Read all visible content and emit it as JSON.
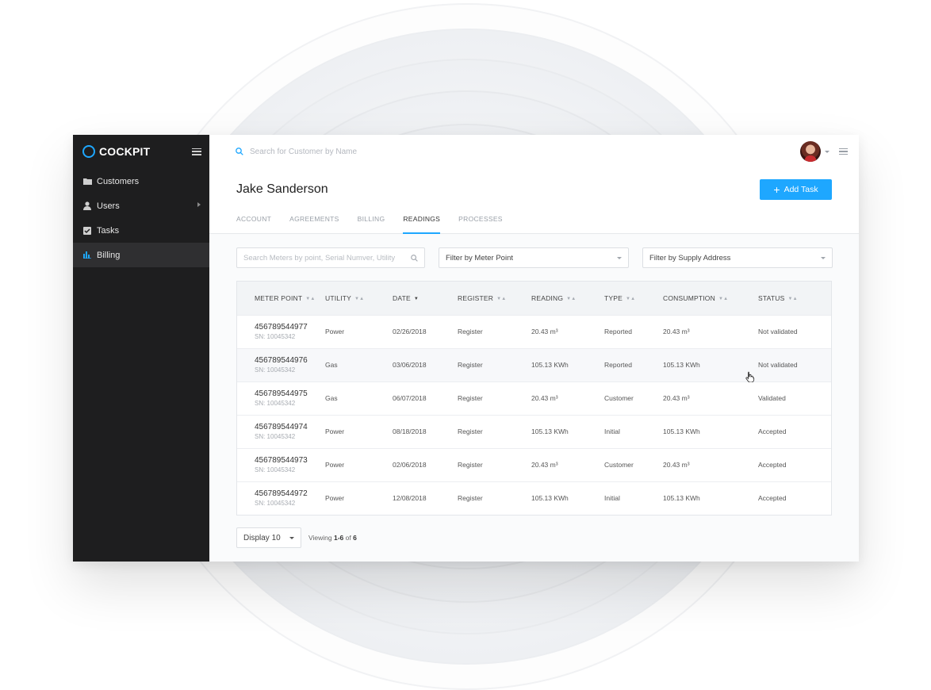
{
  "brand": {
    "name": "COCKPIT",
    "accent": "#1ea7ff"
  },
  "sidebar": {
    "items": [
      {
        "label": "Customers",
        "icon": "folder-icon"
      },
      {
        "label": "Users",
        "icon": "user-icon"
      },
      {
        "label": "Tasks",
        "icon": "checkbox-icon"
      },
      {
        "label": "Billing",
        "icon": "bar-chart-icon",
        "active": true
      }
    ]
  },
  "topbar": {
    "search_placeholder": "Search for Customer by Name"
  },
  "customer": {
    "name": "Jake Sanderson"
  },
  "actions": {
    "add_task": "Add Task"
  },
  "tabs": [
    "ACCOUNT",
    "AGREEMENTS",
    "BILLING",
    "READINGS",
    "PROCESSES"
  ],
  "active_tab": "READINGS",
  "filters": {
    "search_placeholder": "Search Meters by point, Serial Numver, Utility",
    "meter_point": "Filter by Meter Point",
    "supply_address": "Filter by Supply Address"
  },
  "table": {
    "columns": [
      "METER POINT",
      "UTILITY",
      "DATE",
      "REGISTER",
      "READING",
      "TYPE",
      "CONSUMPTION",
      "STATUS"
    ],
    "rows": [
      {
        "meter_point": "456789544977",
        "sn": "SN: 10045342",
        "utility": "Power",
        "date": "02/26/2018",
        "register": "Register",
        "reading": "20.43 m³",
        "type": "Reported",
        "consumption": "20.43 m³",
        "status": "Not validated"
      },
      {
        "meter_point": "456789544976",
        "sn": "SN: 10045342",
        "utility": "Gas",
        "date": "03/06/2018",
        "register": "Register",
        "reading": "105.13 KWh",
        "type": "Reported",
        "consumption": "105.13 KWh",
        "status": "Not validated"
      },
      {
        "meter_point": "456789544975",
        "sn": "SN: 10045342",
        "utility": "Gas",
        "date": "06/07/2018",
        "register": "Register",
        "reading": "20.43 m³",
        "type": "Customer",
        "consumption": "20.43 m³",
        "status": "Validated"
      },
      {
        "meter_point": "456789544974",
        "sn": "SN: 10045342",
        "utility": "Power",
        "date": "08/18/2018",
        "register": "Register",
        "reading": "105.13 KWh",
        "type": "Initial",
        "consumption": "105.13 KWh",
        "status": "Accepted"
      },
      {
        "meter_point": "456789544973",
        "sn": "SN: 10045342",
        "utility": "Power",
        "date": "02/06/2018",
        "register": "Register",
        "reading": "20.43 m³",
        "type": "Customer",
        "consumption": "20.43 m³",
        "status": "Accepted"
      },
      {
        "meter_point": "456789544972",
        "sn": "SN: 10045342",
        "utility": "Power",
        "date": "12/08/2018",
        "register": "Register",
        "reading": "105.13 KWh",
        "type": "Initial",
        "consumption": "105.13 KWh",
        "status": "Accepted"
      }
    ]
  },
  "pagination": {
    "display": "Display 10",
    "viewing_prefix": "Viewing",
    "range": "1-6",
    "of": "of",
    "total": "6"
  }
}
